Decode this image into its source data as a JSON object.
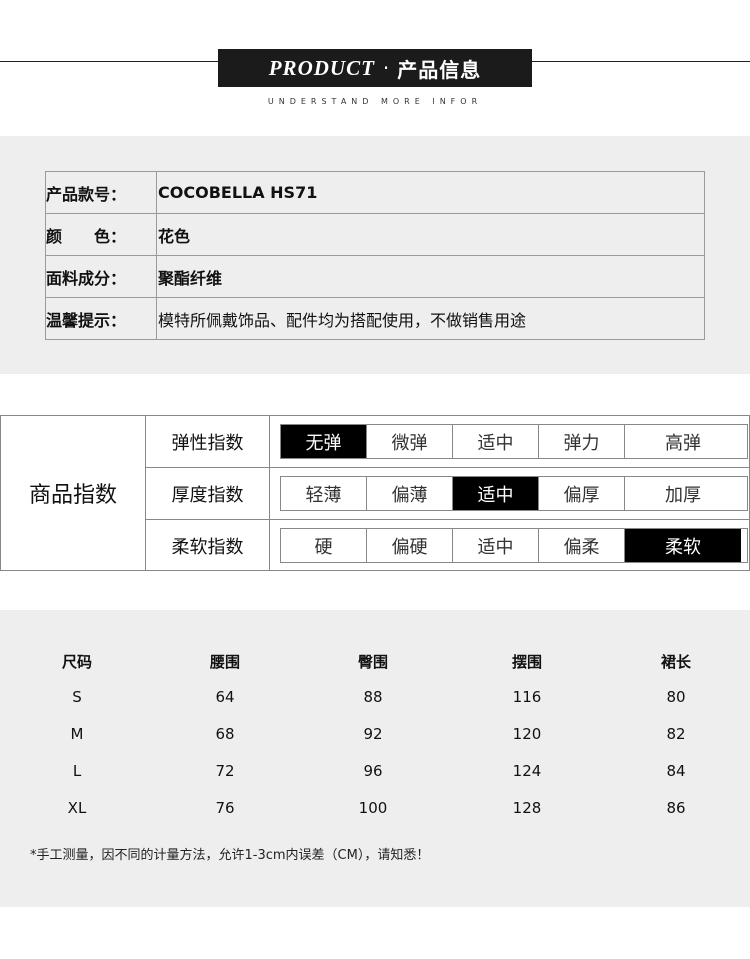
{
  "header": {
    "title_en": "PRODUCT",
    "separator": "·",
    "title_cn": "产品信息",
    "subtitle": "UNDERSTAND MORE INFOR"
  },
  "info": [
    {
      "key": "产品款号：",
      "value": "COCOBELLA HS71"
    },
    {
      "key": "颜　　色：",
      "value": "花色"
    },
    {
      "key": "面料成分：",
      "value": "聚酯纤维"
    },
    {
      "key": "温馨提示：",
      "value": "模特所佩戴饰品、配件均为搭配使用，不做销售用途"
    }
  ],
  "index": {
    "title": "商品指数",
    "rows": [
      {
        "label": "弹性指数",
        "options": [
          "无弹",
          "微弹",
          "适中",
          "弹力",
          "高弹"
        ],
        "selected": "无弹"
      },
      {
        "label": "厚度指数",
        "options": [
          "轻薄",
          "偏薄",
          "适中",
          "偏厚",
          "加厚"
        ],
        "selected": "适中"
      },
      {
        "label": "柔软指数",
        "options": [
          "硬",
          "偏硬",
          "适中",
          "偏柔",
          "柔软"
        ],
        "selected": "柔软"
      }
    ]
  },
  "sizes": {
    "headers": [
      "尺码",
      "腰围",
      "臀围",
      "摆围",
      "裙长"
    ],
    "rows": [
      [
        "S",
        "64",
        "88",
        "116",
        "80"
      ],
      [
        "M",
        "68",
        "92",
        "120",
        "82"
      ],
      [
        "L",
        "72",
        "96",
        "124",
        "84"
      ],
      [
        "XL",
        "76",
        "100",
        "128",
        "86"
      ]
    ],
    "note": "*手工测量，因不同的计量方法，允许1-3cm内误差（CM），请知悉！"
  },
  "colors": {
    "banner": "#1b1b1b",
    "panel": "#eeeeee",
    "selected": "#000000"
  }
}
